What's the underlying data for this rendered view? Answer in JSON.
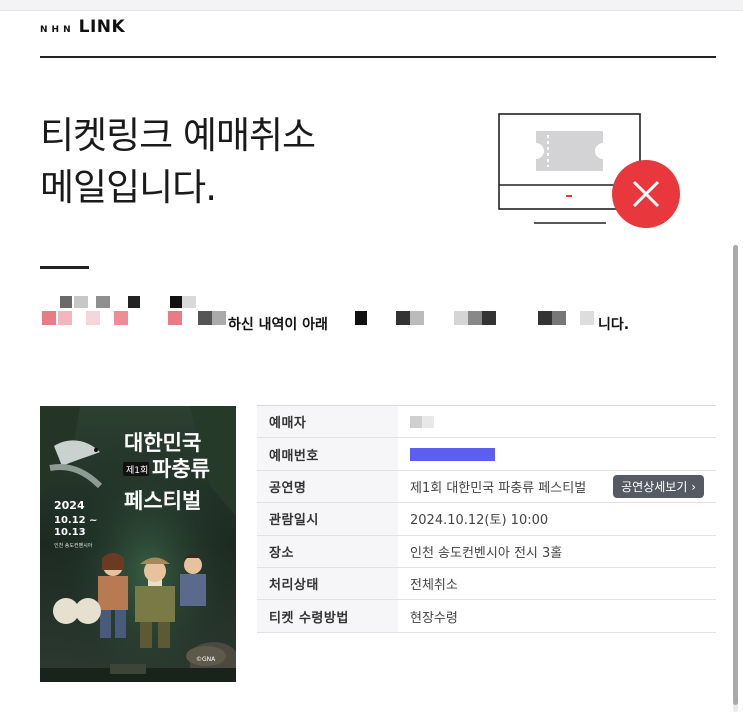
{
  "brand": {
    "prefix": "NHN",
    "name": "LINK"
  },
  "headline": "티켓링크 예매취소\n메일입니다.",
  "intro": {
    "middle": "하신 내역이 아래",
    "end": "니다."
  },
  "details": [
    {
      "label": "예매자",
      "value": ""
    },
    {
      "label": "예매번호",
      "value": ""
    },
    {
      "label": "공연명",
      "value": "제1회 대한민국 파충류 페스티벌",
      "button": "공연상세보기 ›"
    },
    {
      "label": "관람일시",
      "value": "2024.10.12(토) 10:00"
    },
    {
      "label": "장소",
      "value": "인천 송도컨벤시아 전시 3홀"
    },
    {
      "label": "처리상태",
      "value": "전체취소"
    },
    {
      "label": "티켓 수령방법",
      "value": "현장수령"
    }
  ],
  "poster": {
    "title_line1": "대한민국",
    "badge": "제1회",
    "title_line2": "파충류",
    "title_line3": "페스티벌",
    "year": "2024",
    "dates": "10.12 ~",
    "dates2": "10.13",
    "venue": "인천 송도컨벤시아",
    "footer": "©GNA"
  },
  "colors": {
    "accent_red": "#e8383d",
    "redaction_blue": "#5b5ef0",
    "button_bg": "#555a63"
  },
  "icons": {
    "hero": "monitor-ticket-cancel-icon",
    "cancel": "x-icon"
  }
}
